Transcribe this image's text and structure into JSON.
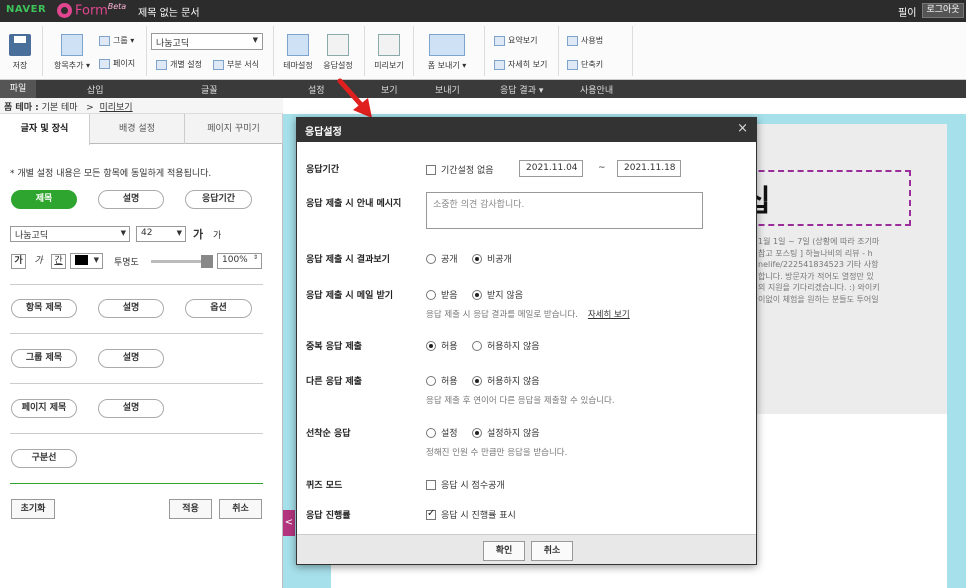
{
  "topbar": {
    "naver": "NAVER",
    "form_logo": "Form",
    "form_beta": "Beta",
    "doc_title": "제목 없는 문서",
    "user": "필이",
    "logout": "로그아웃"
  },
  "ribbon": {
    "save": "저장",
    "add_item": "항목추가 ▾",
    "group": "그룹 ▾",
    "page": "페이지",
    "font_value": "나눔고딕",
    "individual_settings": "개별 설정",
    "partial_style": "부분 서식",
    "form_settings": "테마설정",
    "response_settings": "응답설정",
    "preview": "미리보기",
    "send_form": "폼 보내기 ▾",
    "summary_view": "요약보기",
    "detail_view": "자세히 보기",
    "usage": "사용법",
    "shortcuts": "단축키"
  },
  "tabstrip": [
    "파일",
    "삽입",
    "글꼴",
    "설정",
    "보기",
    "보내기",
    "응답 결과 ▾",
    "사용안내"
  ],
  "crumb": {
    "label": "폼 테마 :",
    "theme": "기본 테마",
    "sep": ">",
    "preview": "미리보기"
  },
  "left": {
    "tabs": [
      "글자 및 장식",
      "배경 설정",
      "페이지 꾸미기"
    ],
    "note": "* 개별 설정 내용은 모든 항목에 동일하게 적용됩니다.",
    "row1": [
      "제목",
      "설명",
      "응답기간"
    ],
    "font": "나눔고딕",
    "size": "42",
    "grow": "가",
    "shrink": "가",
    "bold": "가",
    "italic": "가",
    "underline": "간",
    "opacity_label": "투명도",
    "opacity_value": "100%",
    "row2": [
      "항목 제목",
      "설명",
      "옵션"
    ],
    "row3": [
      "그룹 제목",
      "설명"
    ],
    "row4": [
      "페이지 제목",
      "설명"
    ],
    "divider": "구분선",
    "reset": "초기화",
    "apply": "적용",
    "cancel": "취소"
  },
  "canvas": {
    "title_glyph": "십",
    "body": "1월 1일 ~ 7일 (상황에 따라 조기마\n참고 포스팅 ] 하늘나비의 리뷰 - h\nnelife/222541834523 기타 사항\n합니다. 방문자가 적어도 열정만 있\n의 지원을 기다리겠습니다. :) 와이키\n이없이 체험을 원하는 분들도 투어일",
    "side_tab": "<"
  },
  "dialog": {
    "title": "응답설정",
    "close": "×",
    "period": {
      "label": "응답기간",
      "no_limit": "기간설정 없음",
      "start": "2021.11.04",
      "tilde": "~",
      "end": "2021.11.18"
    },
    "message": {
      "label": "응답 제출 시 안내 메시지",
      "value": "소중한 의견 감사합니다."
    },
    "results": {
      "label": "응답 제출 시 결과보기",
      "opt1": "공개",
      "opt2": "비공개"
    },
    "mail": {
      "label": "응답 제출 시 메일 받기",
      "opt1": "받음",
      "opt2": "받지 않음",
      "desc": "응답 제출 시 응답 결과를 메일로 받습니다.",
      "more": "자세히 보기"
    },
    "duplicate": {
      "label": "중복 응답 제출",
      "opt1": "허용",
      "opt2": "허용하지 않음"
    },
    "other": {
      "label": "다른 응답 제출",
      "opt1": "허용",
      "opt2": "허용하지 않음",
      "desc": "응답 제출 후 연이어 다른 응답을 제출할 수 있습니다."
    },
    "first": {
      "label": "선착순 응답",
      "opt1": "설정",
      "opt2": "설정하지 않음",
      "desc": "정해진 인원 수 만큼만 응답을 받습니다."
    },
    "quiz": {
      "label": "퀴즈 모드",
      "opt": "응답 시 점수공개"
    },
    "progress": {
      "label": "응답 진행률",
      "opt": "응답 시 진행률 표시"
    },
    "ok": "확인",
    "cancel": "취소"
  },
  "colors": {
    "accent_green": "#2ea52e",
    "brand_pink": "#e0458f",
    "arrow_red": "#e0201e"
  }
}
